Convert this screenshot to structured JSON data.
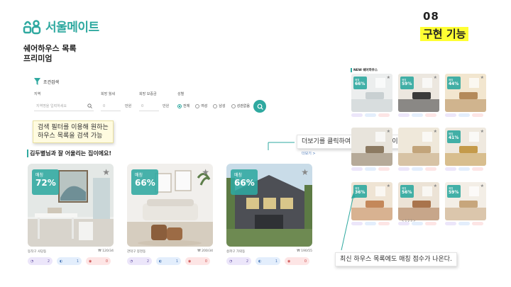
{
  "brand": {
    "name": "서울메이트"
  },
  "slide": {
    "number": "08",
    "title": "구현 기능"
  },
  "subtitle": {
    "line1": "쉐어하우스 목록",
    "line2": "프리미엄"
  },
  "filter": {
    "header": "조건검색",
    "labels": {
      "region": "지역",
      "deposit": "희망 월세",
      "loan": "희망 보증금",
      "gender": "성별"
    },
    "search_placeholder": "지역명을 입력하세요",
    "min_placeholder": "0",
    "unit": "만원",
    "gender_options": [
      "전체",
      "여성",
      "남성",
      "성관없음"
    ],
    "selected_gender": "전체"
  },
  "callouts": {
    "filter": "검색 필터를 이용해 원하는\n하우스 목록을 검색 가능",
    "more": "더보기를 클릭하여 매칭 페이지로 이동",
    "latest": "최신 하우스 목록에도 매칭 점수가 나온다."
  },
  "recommend": {
    "heading": "김두별님과 잘 어울리는 집이에요!",
    "match_label": "매칭",
    "cards": [
      {
        "score": "72%",
        "location": "동작구 사당동",
        "price": "₩ 120/34",
        "scene": "study",
        "pills": [
          "2",
          "1",
          "0"
        ]
      },
      {
        "score": "66%",
        "location": "관악구 봉천동",
        "price": "₩ 200/34",
        "scene": "living",
        "pills": [
          "2",
          "1",
          "0"
        ]
      },
      {
        "score": "66%",
        "location": "송파구 가락동",
        "price": "₩ 190/55",
        "scene": "house",
        "pills": [
          "2",
          "1",
          "0"
        ]
      }
    ]
  },
  "latest": {
    "heading": "NEW 쉐어하우스",
    "more": "더보기 >",
    "pager": "< 1 2 3 >",
    "items": [
      {
        "score": "66%",
        "scene": "white"
      },
      {
        "score": "59%",
        "scene": "tv"
      },
      {
        "score": "44%",
        "scene": "sun"
      },
      {
        "score": "",
        "scene": "hall"
      },
      {
        "score": "",
        "scene": "desk"
      },
      {
        "score": "41%",
        "scene": "frame"
      },
      {
        "score": "36%",
        "scene": "chair"
      },
      {
        "score": "56%",
        "scene": "sofa"
      },
      {
        "score": "59%",
        "scene": "bright"
      }
    ]
  },
  "colors": {
    "accent": "#2fa9a0",
    "highlight": "#ffff33"
  }
}
